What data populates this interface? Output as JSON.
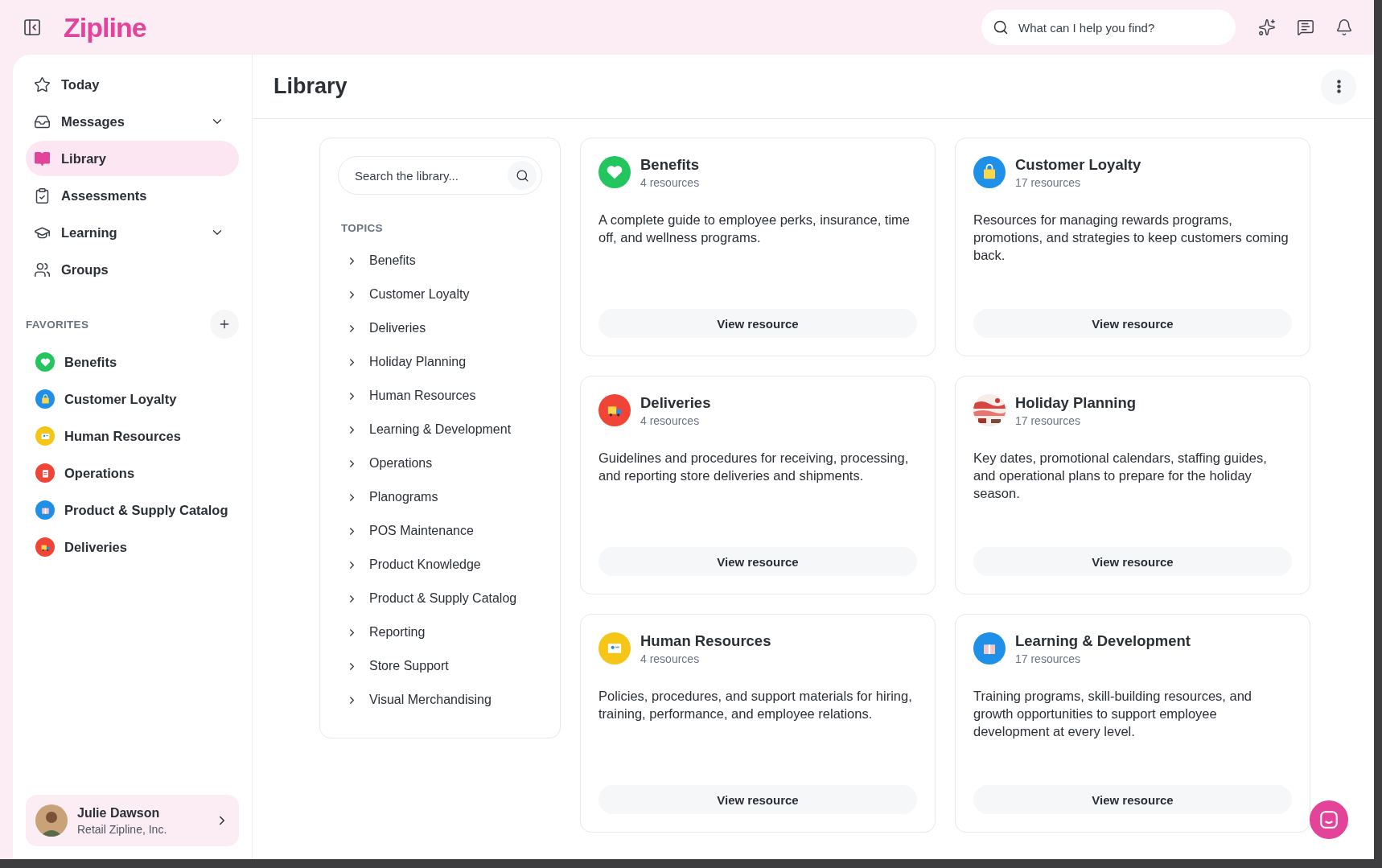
{
  "header": {
    "logo": "Zipline",
    "search": {
      "placeholder": "What can I help you find?"
    }
  },
  "sidebar": {
    "items": [
      {
        "label": "Today",
        "selected": false,
        "expandable": false
      },
      {
        "label": "Messages",
        "selected": false,
        "expandable": true
      },
      {
        "label": "Library",
        "selected": true,
        "expandable": false
      },
      {
        "label": "Assessments",
        "selected": false,
        "expandable": false
      },
      {
        "label": "Learning",
        "selected": false,
        "expandable": true
      },
      {
        "label": "Groups",
        "selected": false,
        "expandable": false
      }
    ],
    "favorites_title": "FAVORITES",
    "favorites": [
      {
        "label": "Benefits",
        "color": "#22c55e"
      },
      {
        "label": "Customer Loyalty",
        "color": "#1e90e8"
      },
      {
        "label": "Human Resources",
        "color": "#f5c518"
      },
      {
        "label": "Operations",
        "color": "#ef4436"
      },
      {
        "label": "Product & Supply Catalog",
        "color": "#1e90e8"
      },
      {
        "label": "Deliveries",
        "color": "#ef4436"
      }
    ],
    "user": {
      "name": "Julie Dawson",
      "org": "Retail Zipline, Inc."
    }
  },
  "page": {
    "title": "Library"
  },
  "topics": {
    "search_placeholder": "Search the library...",
    "title": "TOPICS",
    "items": [
      "Benefits",
      "Customer Loyalty",
      "Deliveries",
      "Holiday Planning",
      "Human Resources",
      "Learning & Development",
      "Operations",
      "Planograms",
      "POS Maintenance",
      "Product Knowledge",
      "Product & Supply Catalog",
      "Reporting",
      "Store Support",
      "Visual Merchandising"
    ]
  },
  "cards": [
    {
      "title": "Benefits",
      "count": "4 resources",
      "kind": "emblem",
      "color": "#22c55e",
      "description": "A complete guide to employee perks, insurance, time off, and wellness programs.",
      "button": "View resource"
    },
    {
      "title": "Customer Loyalty",
      "count": "17 resources",
      "kind": "emblem",
      "color": "#1e90e8",
      "description": "Resources for managing rewards programs, promotions, and strategies to keep customers coming back.",
      "button": "View resource"
    },
    {
      "title": "Deliveries",
      "count": "4 resources",
      "kind": "emblem",
      "color": "#ef4436",
      "description": "Guidelines and procedures for receiving, processing, and reporting store deliveries and shipments.",
      "button": "View resource"
    },
    {
      "title": "Holiday Planning",
      "count": "17 resources",
      "kind": "picture",
      "description": "Key dates, promotional calendars, staffing guides, and operational plans to prepare for the holiday season.",
      "button": "View resource"
    },
    {
      "title": "Human Resources",
      "count": "4 resources",
      "kind": "emblem",
      "color": "#f5c518",
      "description": "Policies, procedures, and support materials for hiring, training, performance, and employee relations.",
      "button": "View resource"
    },
    {
      "title": "Learning & Development",
      "count": "17 resources",
      "kind": "emblem",
      "color": "#1e90e8",
      "description": "Training programs, skill-building resources, and growth opportunities to support employee development at every level.",
      "button": "View resource"
    }
  ]
}
